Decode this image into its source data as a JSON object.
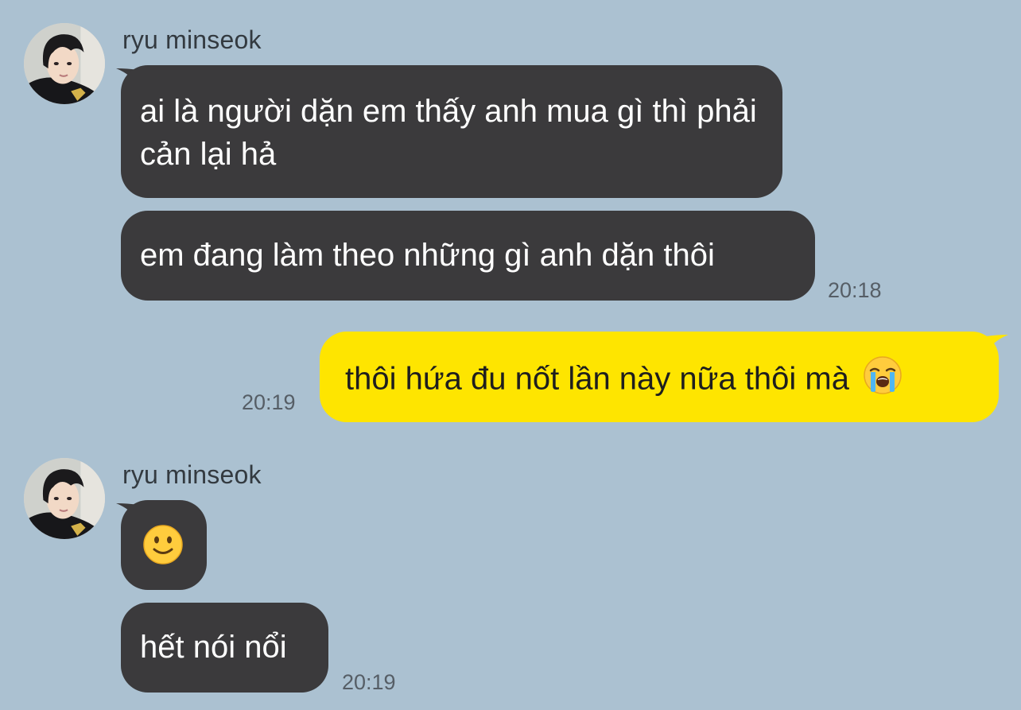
{
  "conversation": {
    "groups": [
      {
        "sender": "ryu minseok",
        "messages": [
          {
            "text": "ai là người dặn em thấy anh mua gì thì phải cản lại hả"
          },
          {
            "text": "em đang làm theo những gì anh dặn thôi"
          }
        ],
        "time": "20:18"
      },
      {
        "outgoing": true,
        "messages": [
          {
            "text": "thôi hứa đu nốt lần này nữa thôi mà",
            "emoji": "loudly-crying-face"
          }
        ],
        "time": "20:19"
      },
      {
        "sender": "ryu minseok",
        "messages": [
          {
            "emoji": "slightly-smiling-face"
          },
          {
            "text": "hết nói nổi"
          }
        ],
        "time": "20:19"
      }
    ]
  },
  "colors": {
    "background": "#abc1d1",
    "incoming_bubble": "#3b3a3c",
    "outgoing_bubble": "#fee500",
    "incoming_text": "#ffffff",
    "outgoing_text": "#1e1e1e",
    "timestamp": "#565e66",
    "sender_name": "#333a40"
  }
}
